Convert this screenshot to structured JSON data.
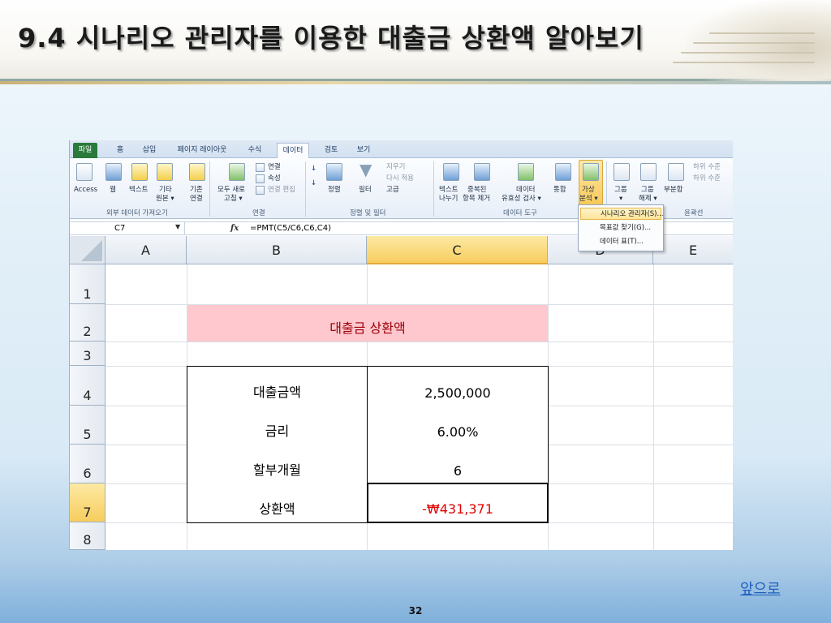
{
  "slide": {
    "title": "9.4 시나리오 관리자를 이용한 대출금 상환액 알아보기",
    "next_link": "앞으로",
    "page_number": "32"
  },
  "excel": {
    "tabs": [
      "파일",
      "홈",
      "삽입",
      "페이지 레이아웃",
      "수식",
      "데이터",
      "검토",
      "보기"
    ],
    "active_tab": "데이터",
    "ribbon": {
      "access": "Access",
      "web": "웹",
      "text": "텍스트",
      "other": "기타",
      "other2": "원본 ▾",
      "existing": "기존",
      "existing2": "연결",
      "group_external": "외부 데이터 가져오기",
      "refresh_all": "모두 새로",
      "refresh_all2": "고침 ▾",
      "connections": "연결",
      "properties": "속성",
      "edit_links": "연결 편집",
      "group_connections": "연결",
      "sort": "정렬",
      "filter": "필터",
      "clear": "지우기",
      "reapply": "다시 적용",
      "advanced": "고급",
      "group_sort_filter": "정렬 및 필터",
      "text_to_columns": "텍스트",
      "text_to_columns2": "나누기",
      "remove_dup": "중복된",
      "remove_dup2": "항목 제거",
      "validation": "데이터",
      "validation2": "유효성 검사 ▾",
      "consolidate": "통합",
      "group_data_tools": "데이터 도구",
      "whatif": "가상",
      "whatif2": "분석 ▾",
      "group": "그룹",
      "group_arrow": "▾",
      "ungroup": "그룹",
      "ungroup2": "해제 ▾",
      "subtotal": "부분합",
      "show_detail": "하위 수준",
      "hide_detail": "하위 수준",
      "group_outline": "윤곽선"
    },
    "name_box": "C7",
    "formula": "=PMT(C5/C6,C6,C4)",
    "columns": [
      "A",
      "B",
      "C",
      "D",
      "E"
    ],
    "rows": [
      "1",
      "2",
      "3",
      "4",
      "5",
      "6",
      "7",
      "8"
    ],
    "cells": {
      "title": "대출금 상환액",
      "loan_label": "대출금액",
      "loan_value": "2,500,000",
      "rate_label": "금리",
      "rate_value": "6.00%",
      "months_label": "할부개월",
      "months_value": "6",
      "payment_label": "상환액",
      "payment_value": "-₩431,371"
    },
    "whatif_menu": [
      "시나리오 관리자(S)...",
      "목표값 찾기(G)...",
      "데이터 표(T)..."
    ]
  }
}
